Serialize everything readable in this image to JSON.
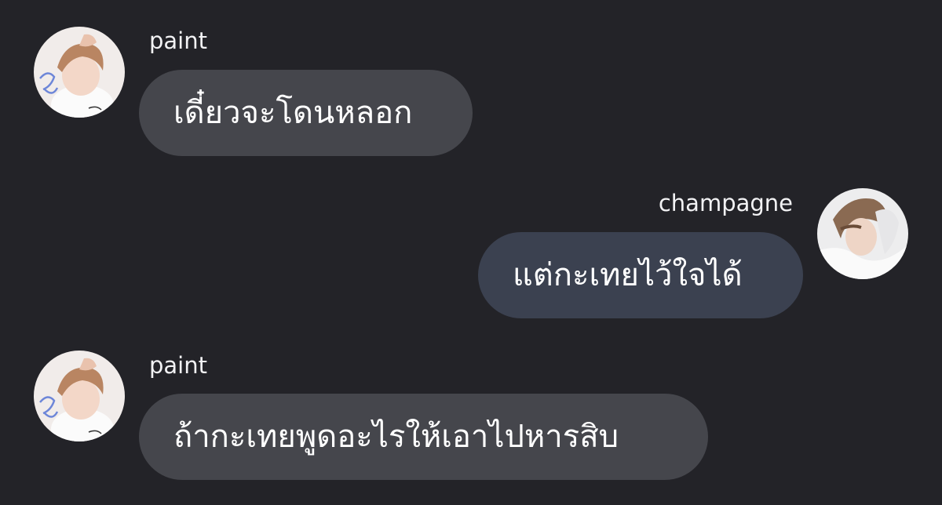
{
  "chat": {
    "messages": [
      {
        "sender": "paint",
        "direction": "incoming",
        "text": "เดี๋ยวจะโดนหลอก",
        "avatar": "paint-avatar"
      },
      {
        "sender": "champagne",
        "direction": "outgoing",
        "text": "แต่กะเทยไว้ใจได้",
        "avatar": "champagne-avatar"
      },
      {
        "sender": "paint",
        "direction": "incoming",
        "text": "ถ้ากะเทยพูดอะไรให้เอาไปหารสิบ",
        "avatar": "paint-avatar"
      }
    ]
  },
  "theme": {
    "background": "#232328",
    "incoming_bubble": "#45464c",
    "outgoing_bubble": "#3b4150",
    "text": "#ffffff"
  }
}
